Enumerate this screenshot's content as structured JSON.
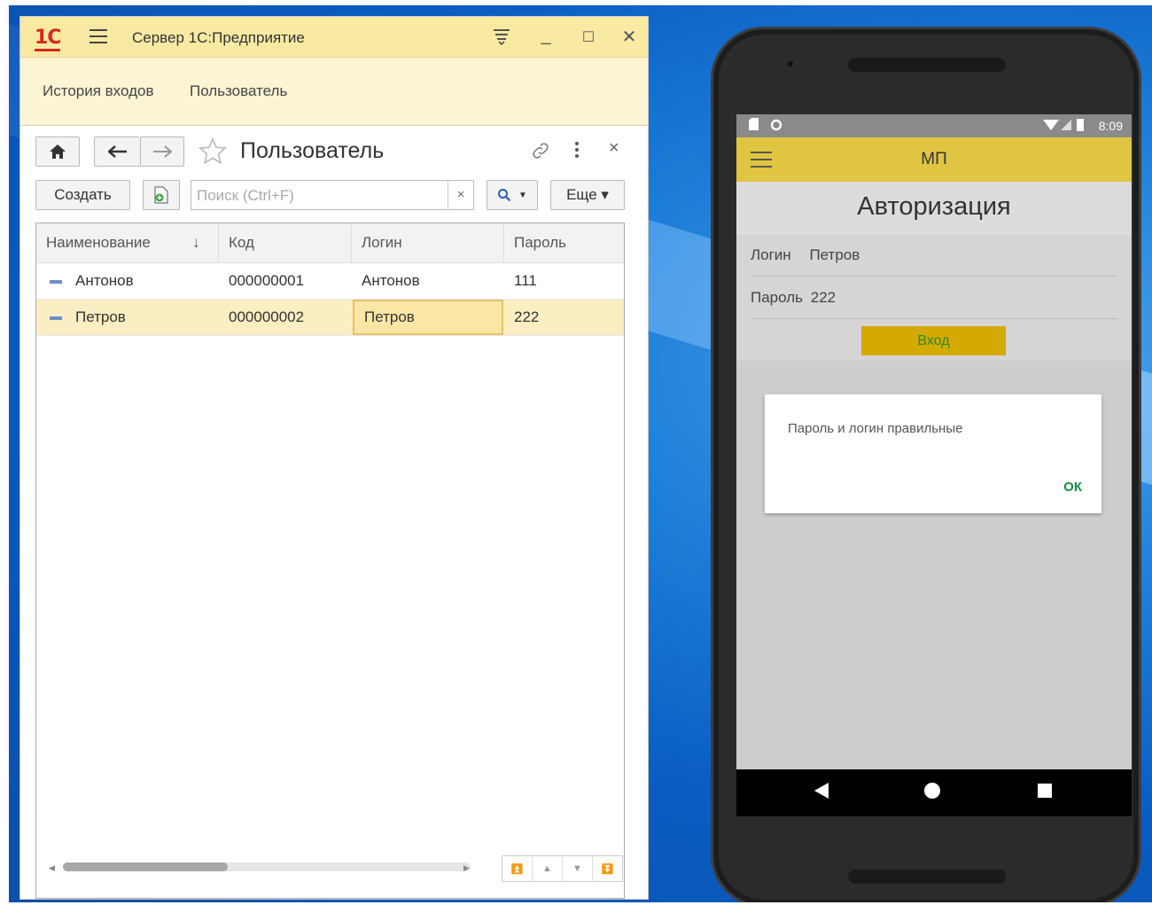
{
  "window": {
    "logo": "1С",
    "title": "Сервер 1С:Предприятие",
    "controls": [
      "⩸",
      "_",
      "☐",
      "✕"
    ]
  },
  "sections": [
    "История входов",
    "Пользователь"
  ],
  "form": {
    "title": "Пользователь",
    "create_label": "Создать",
    "search_placeholder": "Поиск (Ctrl+F)",
    "clear_label": "×",
    "more_label": "Еще ▾",
    "search_btn": "🔍 ▾"
  },
  "grid": {
    "columns": [
      "Наименование",
      "Код",
      "Логин",
      "Пароль"
    ],
    "sort_indicator": "↓",
    "rows": [
      {
        "name": "Антонов",
        "code": "000000001",
        "login": "Антонов",
        "password": "111"
      },
      {
        "name": "Петров",
        "code": "000000002",
        "login": "Петров",
        "password": "222"
      }
    ]
  },
  "phone": {
    "time": "8:09",
    "app_title": "МП",
    "screen_title": "Авторизация",
    "login_label": "Логин",
    "login_value": "Петров",
    "password_label": "Пароль",
    "password_value": "222",
    "login_button": "Вход",
    "dialog_message": "Пароль и логин правильные",
    "dialog_ok": "ОК"
  },
  "colors": {
    "titlebar": "#f9eaa3",
    "selected_row": "#fbeec2",
    "phone_accent": "#e0c542",
    "login_btn": "#d4a900"
  }
}
